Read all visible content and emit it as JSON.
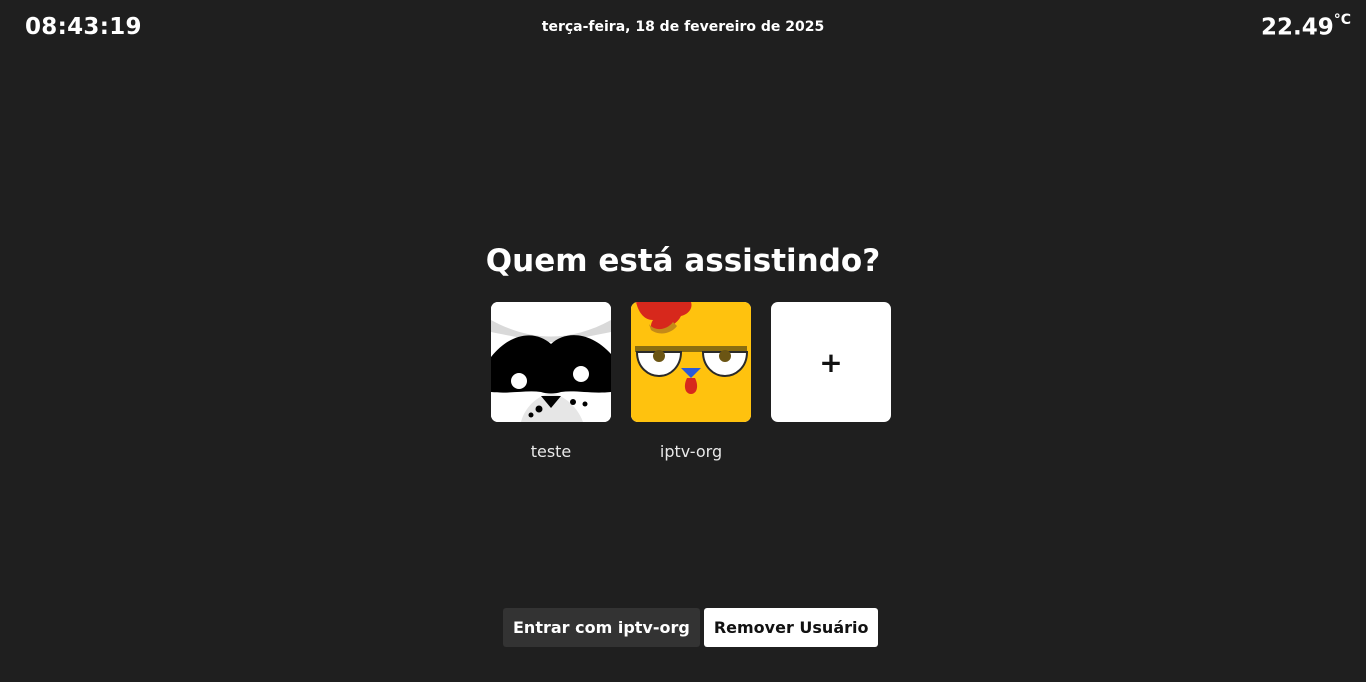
{
  "header": {
    "time": "08:43:19",
    "date": "terça-feira, 18 de fevereiro de 2025",
    "temperature": "22.49",
    "temperature_unit": "°C"
  },
  "main": {
    "title": "Quem está assistindo?",
    "profiles": [
      {
        "name": "teste",
        "avatar_icon": "raccoon-mask-avatar-icon"
      },
      {
        "name": "iptv-org",
        "avatar_icon": "yellow-chicken-avatar-icon"
      }
    ],
    "add_profile_label": "+"
  },
  "actions": {
    "login_label": "Entrar com iptv-org",
    "remove_label": "Remover Usuário"
  },
  "colors": {
    "background": "#1f1f1f",
    "text": "#ffffff",
    "button_dark": "#333333",
    "button_light": "#ffffff",
    "chicken_yellow": "#ffc20e",
    "chicken_comb": "#d7281c"
  }
}
